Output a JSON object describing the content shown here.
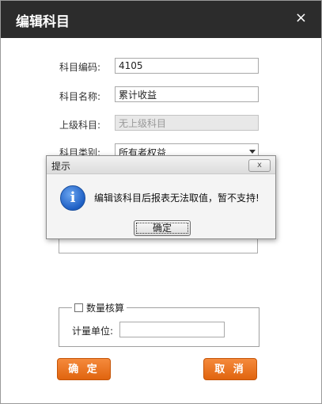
{
  "window": {
    "title": "编辑科目",
    "close_icon": "×"
  },
  "form": {
    "code_label": "科目编码:",
    "code_value": "4105",
    "name_label": "科目名称:",
    "name_value": "累计收益",
    "parent_label": "上级科目:",
    "parent_value": "无上级科目",
    "type_label": "科目类别:",
    "type_value": "所有者权益"
  },
  "quantity": {
    "checkbox_label": "数量核算",
    "unit_label": "计量单位:",
    "unit_value": ""
  },
  "buttons": {
    "confirm": "确 定",
    "cancel": "取 消"
  },
  "dialog": {
    "title": "提示",
    "close_icon": "x",
    "icon": "i",
    "message": "编辑该科目后报表无法取值，暂不支持!",
    "ok": "确定"
  },
  "colors": {
    "titlebar": "#2c2c2c",
    "accent_orange": "#e8731f"
  }
}
